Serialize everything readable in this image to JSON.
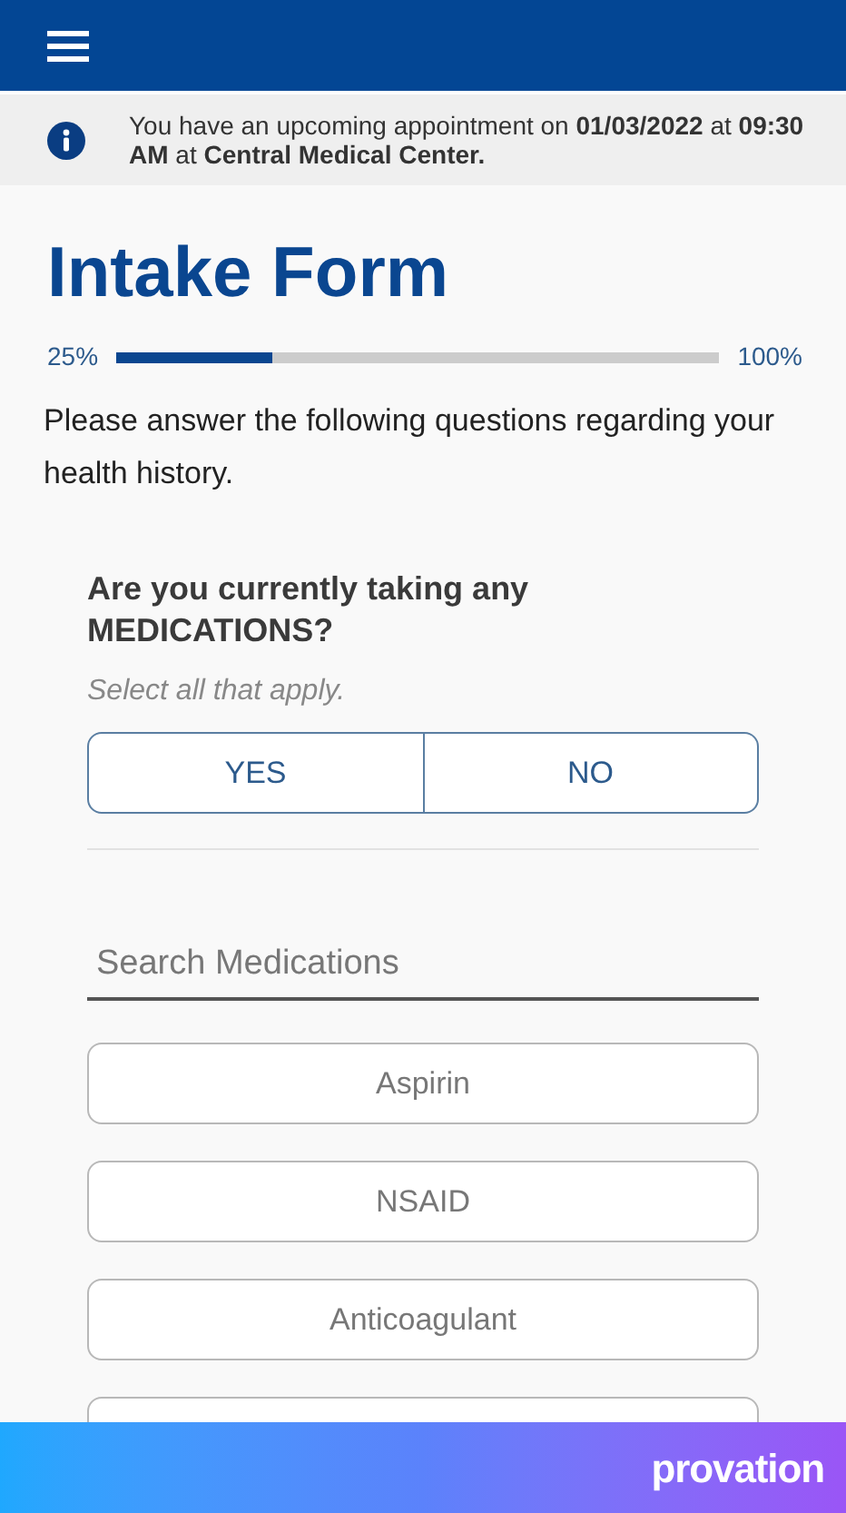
{
  "notice": {
    "text": "You have an upcoming appointment on **01/03/2022** at **09:30 AM** at **Central Medical Center.**"
  },
  "title": "Intake Form",
  "progress": {
    "start_label": "25%",
    "end_label": "100%",
    "level": 0.26
  },
  "intro": "Please answer the following questions regarding your health history.",
  "question": {
    "text": "Are you currently taking any MEDICATIONS?",
    "hint": "Select all that apply.",
    "options": [
      {
        "label": "YES",
        "selected": false
      },
      {
        "label": "NO",
        "selected": false
      }
    ]
  },
  "search": {
    "placeholder": "Search Medications"
  },
  "medications": [
    {
      "label": "Aspirin",
      "selected": false
    },
    {
      "label": "NSAID",
      "selected": false
    },
    {
      "label": "Anticoagulant",
      "selected": false
    }
  ],
  "more_medications_below": true,
  "footer": {
    "logo": "provation"
  }
}
